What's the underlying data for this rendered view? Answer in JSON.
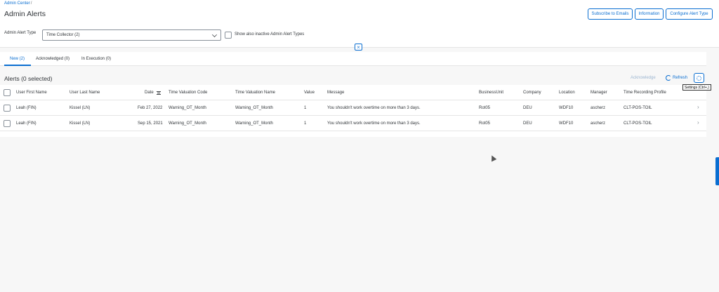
{
  "header": {
    "breadcrumb": "Admin Center",
    "breadcrumb_sep": "/",
    "title": "Admin Alerts",
    "buttons": {
      "subscribe": "Subscribe to Emails",
      "information": "Information",
      "configure": "Configure Alert Type"
    }
  },
  "filter": {
    "label": "Admin Alert Type",
    "selected": "Time Collector (2)",
    "show_inactive_label": "Show also inactive Admin Alert Types"
  },
  "tabs": [
    {
      "label": "New (2)"
    },
    {
      "label": "Acknowledged (0)"
    },
    {
      "label": "In Execution (0)"
    }
  ],
  "toolbar": {
    "title": "Alerts (0 selected)",
    "acknowledge": "Acknowledge",
    "refresh": "Refresh",
    "settings_tooltip": "Settings (Ctrl+,)"
  },
  "table": {
    "columns": [
      "User First Name",
      "User Last Name",
      "Date",
      "Time Valuation Code",
      "Time Valuation Name",
      "Value",
      "Message",
      "BusinessUnit",
      "Company",
      "Location",
      "Manager",
      "Time Recording Profile"
    ],
    "rows": [
      [
        "Leah (FIN)",
        "Kissel (LN)",
        "Feb 27, 2022",
        "Warning_OT_Month",
        "Warning_OT_Month",
        "1",
        "You shouldn't work overtime on more than 3 days.",
        "Rot05",
        "DEU",
        "WDF10",
        "ascherz",
        "CLT-POS-TOIL"
      ],
      [
        "Leah (FIN)",
        "Kissel (LN)",
        "Sep 15, 2021",
        "Warning_OT_Month",
        "Warning_OT_Month",
        "1",
        "You shouldn't work overtime on more than 3 days.",
        "Rot05",
        "DEU",
        "WDF10",
        "ascherz",
        "CLT-POS-TOIL"
      ]
    ]
  },
  "colors": {
    "accent": "#0a6ed1",
    "text": "#32363a",
    "background": "#f7f7f7"
  }
}
